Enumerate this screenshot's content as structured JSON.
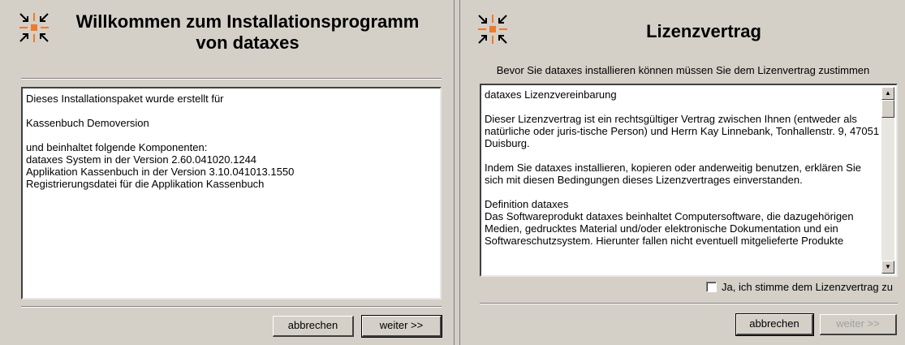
{
  "welcome_dialog": {
    "title_line1": "Willkommen zum Installationsprogramm",
    "title_line2": "von dataxes",
    "info_lines": [
      "Dieses Installationspaket wurde erstellt für",
      "Kassenbuch Demoversion",
      "und beinhaltet folgende Komponenten:\ndataxes System in der Version 2.60.041020.1244\nApplikation Kassenbuch in der Version 3.10.041013.1550\nRegistrierungsdatei für die Applikation Kassenbuch"
    ],
    "cancel_label": "abbrechen",
    "next_label": "weiter >>"
  },
  "license_dialog": {
    "title": "Lizenzvertrag",
    "subtitle": "Bevor Sie dataxes installieren können müssen Sie dem Lizenvertrag zustimmen",
    "license_paragraphs": [
      "dataxes Lizenzvereinbarung",
      "Dieser Lizenzvertrag ist ein rechtsgültiger Vertrag zwischen Ihnen (entweder als natürliche oder juris-tische Person) und Herrn Kay Linnebank, Tonhallenstr. 9, 47051 Duisburg.",
      "Indem Sie dataxes installieren, kopieren oder anderweitig benutzen, erklären Sie sich mit diesen Bedingungen dieses Lizenzvertrages einverstanden.",
      "Definition dataxes\nDas Softwareprodukt dataxes beinhaltet Computersoftware, die dazugehörigen Medien, gedrucktes Material und/oder elektronische Dokumentation und ein Softwareschutzsystem. Hierunter fallen nicht eventuell mitgelieferte Produkte"
    ],
    "agree_label": "Ja, ich stimme dem Lizenzvertrag zu",
    "agree_checked": false,
    "cancel_label": "abbrechen",
    "next_label": "weiter >>",
    "next_enabled": false
  },
  "icons": {
    "logo": "arrows-converge-icon",
    "scroll_up": "scroll-up-arrow-icon",
    "scroll_down": "scroll-down-arrow-icon"
  },
  "colors": {
    "dialog_bg": "#d4d0c8",
    "logo_orange": "#f07a28",
    "logo_black": "#000000"
  }
}
